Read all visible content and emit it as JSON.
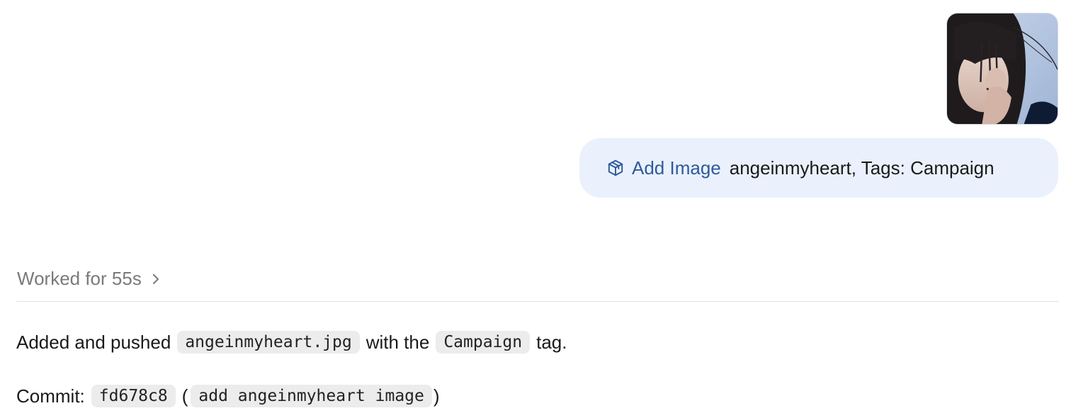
{
  "attachment": {
    "alt": "attached image thumbnail",
    "icon": "image-thumbnail"
  },
  "user_message": {
    "skill_icon": "cube-icon",
    "skill_label": "Add Image",
    "text": "angeinmyheart, Tags: Campaign"
  },
  "work_status": {
    "label": "Worked for 55s",
    "chevron_icon": "chevron-right-icon"
  },
  "response": {
    "line1": {
      "prefix": "Added and pushed",
      "file_code": "angeinmyheart.jpg",
      "middle": "with the",
      "tag_code": "Campaign",
      "suffix": "tag."
    },
    "line2": {
      "prefix": "Commit:",
      "hash_code": "fd678c8",
      "open_paren": "(",
      "message_code": "add angeinmyheart image",
      "close_paren": ")"
    }
  },
  "colors": {
    "bubble_bg": "#eaf1fc",
    "skill_blue": "#2f5a9c",
    "muted_text": "#7a7a7a",
    "code_bg": "#ececec"
  }
}
